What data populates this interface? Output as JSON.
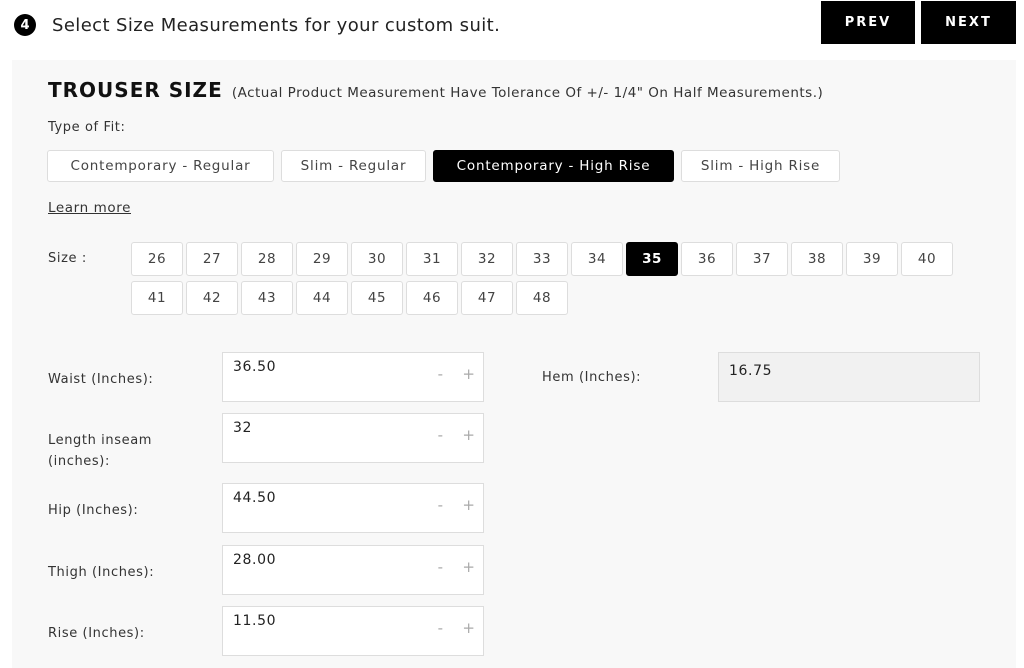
{
  "header": {
    "step_number": "4",
    "title": "Select Size Measurements for your custom suit.",
    "prev_label": "PREV",
    "next_label": "NEXT"
  },
  "section": {
    "title": "TROUSER SIZE",
    "note": "(Actual Product Measurement Have Tolerance Of +/- 1/4\" On Half Measurements.)"
  },
  "fit": {
    "label": "Type of Fit:",
    "options": [
      {
        "label": "Contemporary - Regular",
        "selected": false
      },
      {
        "label": "Slim - Regular",
        "selected": false
      },
      {
        "label": "Contemporary - High Rise",
        "selected": true
      },
      {
        "label": "Slim - High Rise",
        "selected": false
      }
    ],
    "learn_more": "Learn more"
  },
  "size": {
    "label": "Size :",
    "selected": "35",
    "row1": [
      "26",
      "27",
      "28",
      "29",
      "30",
      "31",
      "32",
      "33",
      "34",
      "35",
      "36",
      "37",
      "38",
      "39",
      "40"
    ],
    "row2": [
      "41",
      "42",
      "43",
      "44",
      "45",
      "46",
      "47",
      "48"
    ]
  },
  "measurements": [
    {
      "label": "Waist (Inches):",
      "value": "36.50"
    },
    {
      "label": "Length inseam (inches):",
      "value": "32"
    },
    {
      "label": "Hip (Inches):",
      "value": "44.50"
    },
    {
      "label": "Thigh (Inches):",
      "value": "28.00"
    },
    {
      "label": "Rise (Inches):",
      "value": "11.50"
    }
  ],
  "stepper": {
    "minus": "-",
    "plus": "+"
  },
  "hem": {
    "label": "Hem (Inches):",
    "value": "16.75"
  }
}
